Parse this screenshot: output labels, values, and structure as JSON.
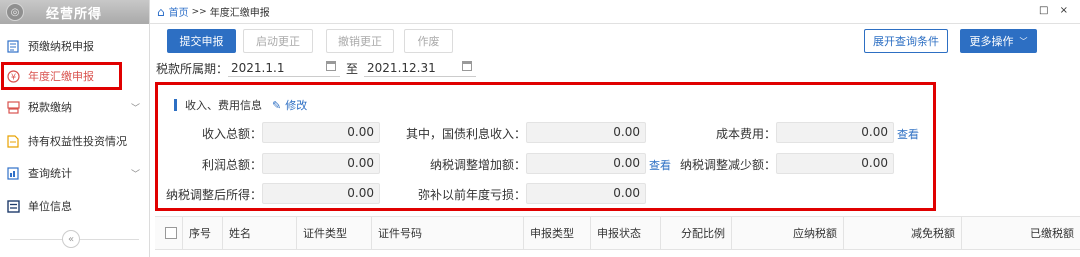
{
  "sidebar": {
    "title": "经营所得",
    "items": [
      {
        "label": "预缴纳税申报"
      },
      {
        "label": "年度汇缴申报"
      },
      {
        "label": "税款缴纳"
      },
      {
        "label": "持有权益性投资情况"
      },
      {
        "label": "查询统计"
      },
      {
        "label": "单位信息"
      }
    ],
    "collapse_label": "«"
  },
  "breadcrumb": {
    "home": "首页",
    "separator": ">>",
    "current": "年度汇缴申报"
  },
  "window_controls": "□ ×",
  "toolbar": {
    "submit": "提交申报",
    "start_correction": "启动更正",
    "cancel_correction": "撤销更正",
    "void": "作废",
    "expand_query": "展开查询条件",
    "more_ops": "更多操作"
  },
  "period": {
    "label": "税款所属期：",
    "start": "2021.1.1",
    "to": "至",
    "end": "2021.12.31"
  },
  "info": {
    "title": "收入、费用信息",
    "edit": "修改",
    "fields": {
      "total_income_label": "收入总额：",
      "total_income": "0.00",
      "bond_interest_label": "其中，国债利息收入：",
      "bond_interest": "0.00",
      "cost_label": "成本费用：",
      "cost": "0.00",
      "total_profit_label": "利润总额：",
      "total_profit": "0.00",
      "adj_increase_label": "纳税调整增加额：",
      "adj_increase": "0.00",
      "adj_decrease_label": "纳税调整减少额：",
      "adj_decrease": "0.00",
      "adjusted_income_label": "纳税调整后所得：",
      "adjusted_income": "0.00",
      "prior_loss_label": "弥补以前年度亏损：",
      "prior_loss": "0.00"
    },
    "view_link": "查看"
  },
  "table": {
    "columns": [
      "序号",
      "姓名",
      "证件类型",
      "证件号码",
      "申报类型",
      "申报状态",
      "分配比例",
      "应纳税额",
      "减免税额",
      "已缴税额"
    ]
  },
  "colors": {
    "primary": "#2d6fc3",
    "highlight_border": "#e00000",
    "active_nav": "#d9534f"
  }
}
